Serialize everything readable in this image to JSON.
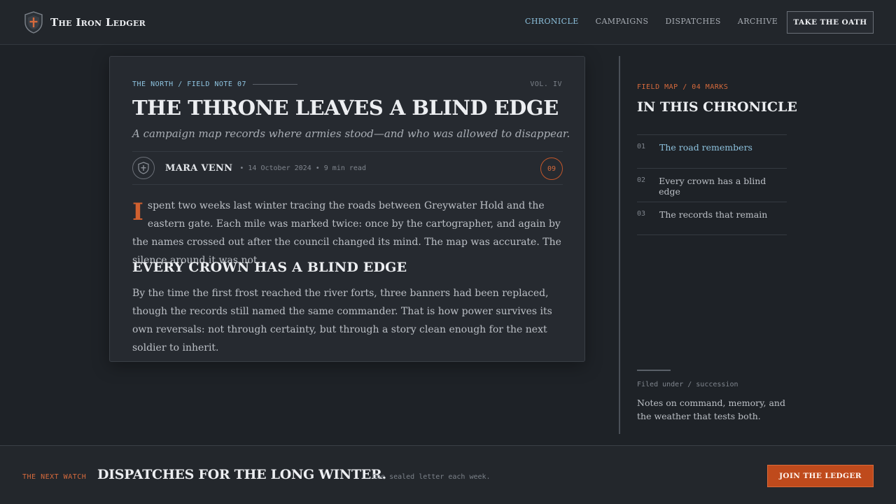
{
  "header": {
    "brand_name": "The Iron Ledger",
    "nav": [
      {
        "label": "CHRONICLE",
        "active": true
      },
      {
        "label": "CAMPAIGNS",
        "active": false
      },
      {
        "label": "DISPATCHES",
        "active": false
      },
      {
        "label": "ARCHIVE",
        "active": false
      }
    ],
    "cta_label": "TAKE THE OATH"
  },
  "article": {
    "breadcrumb": "THE NORTH / FIELD NOTE 07",
    "volume": "VOL. IV",
    "headline": "THE THRONE LEAVES A BLIND EDGE",
    "dek": "A campaign map records where armies stood—and who was allowed to disappear.",
    "author": "MARA VENN",
    "meta": "• 14 October 2024 • 9 min read",
    "badge_count": "09",
    "dropcap": "I",
    "paragraph1": "spent two weeks last winter tracing the roads between Greywater Hold and the eastern gate. Each mile was marked twice: once by the cartographer, and again by the names crossed out after the council changed its mind. The map was accurate. The silence around it was not.",
    "subheading": "EVERY CROWN HAS A BLIND EDGE",
    "paragraph2": "By the time the first frost reached the river forts, three banners had been replaced, though the records still named the same commander. That is how power survives its own reversals: not through certainty, but through a story clean enough for the next soldier to inherit."
  },
  "sidebar": {
    "kicker": "FIELD MAP / 04 MARKS",
    "title": "IN THIS CHRONICLE",
    "items": [
      {
        "num": "01",
        "label": "The road remembers",
        "active": true
      },
      {
        "num": "02",
        "label": "Every crown has a blind edge",
        "active": false
      },
      {
        "num": "03",
        "label": "The records that remain",
        "active": false
      }
    ],
    "filed_under": "Filed under / succession",
    "note": "Notes on command, memory, and the weather that tests both."
  },
  "footer": {
    "kicker": "THE NEXT WATCH",
    "title": "DISPATCHES FOR THE LONG WINTER.",
    "subtitle": "One sealed letter each week.",
    "cta_label": "JOIN THE LEDGER"
  },
  "colors": {
    "accent_blue": "#8ec3df",
    "accent_orange": "#d66a3c",
    "button_orange": "#bf4a1c",
    "background": "#1e2227"
  },
  "icons": {
    "brand": "shield-cross-icon",
    "avatar": "shield-cross-icon"
  }
}
